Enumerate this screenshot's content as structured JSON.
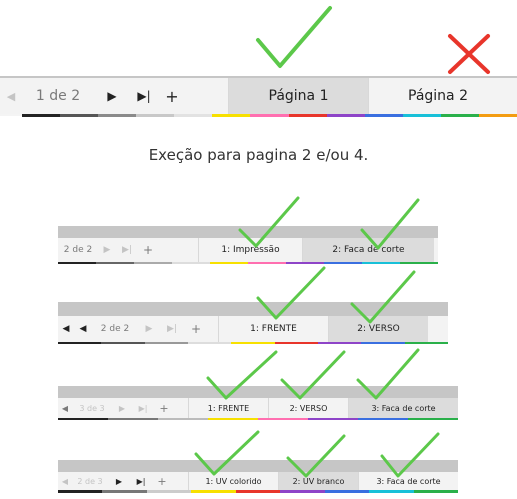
{
  "strip_main": {
    "nav": {
      "prev": "◀",
      "page": "1 de 2",
      "next": "▶",
      "last": "▶|",
      "add": "+"
    },
    "tabs": [
      "Página 1",
      "Página 2"
    ]
  },
  "caption": "Exeção  para pagina 2 e/ou 4.",
  "strip_a": {
    "nav": {
      "page": "2 de 2",
      "next": "▶",
      "last": "▶|",
      "add": "+"
    },
    "tabs": [
      "1: Impressão",
      "2: Faca de corte"
    ]
  },
  "strip_b": {
    "nav": {
      "first": "◀",
      "prev": "◀",
      "page": "2 de 2",
      "next": "▶",
      "last": "▶|",
      "add": "+"
    },
    "tabs": [
      "1: FRENTE",
      "2: VERSO"
    ]
  },
  "strip_c": {
    "nav": {
      "prev": "◀",
      "page": "3 de 3",
      "next": "▶",
      "last": "▶|",
      "add": "+"
    },
    "tabs": [
      "1: FRENTE",
      "2: VERSO",
      "3: Faca de corte"
    ]
  },
  "strip_d": {
    "nav": {
      "prev": "◀",
      "page": "2 de 3",
      "next": "▶",
      "last": "▶|",
      "add": "+"
    },
    "tabs": [
      "1: UV colorido",
      "2: UV branco",
      "3: Faca de corte"
    ]
  },
  "colors": {
    "check": "#5cc84a",
    "cross": "#e8352b",
    "bar_gray": "#c6c6c6",
    "tab_bg": "#f3f3f3",
    "tab_active": "#dcdcdc"
  }
}
